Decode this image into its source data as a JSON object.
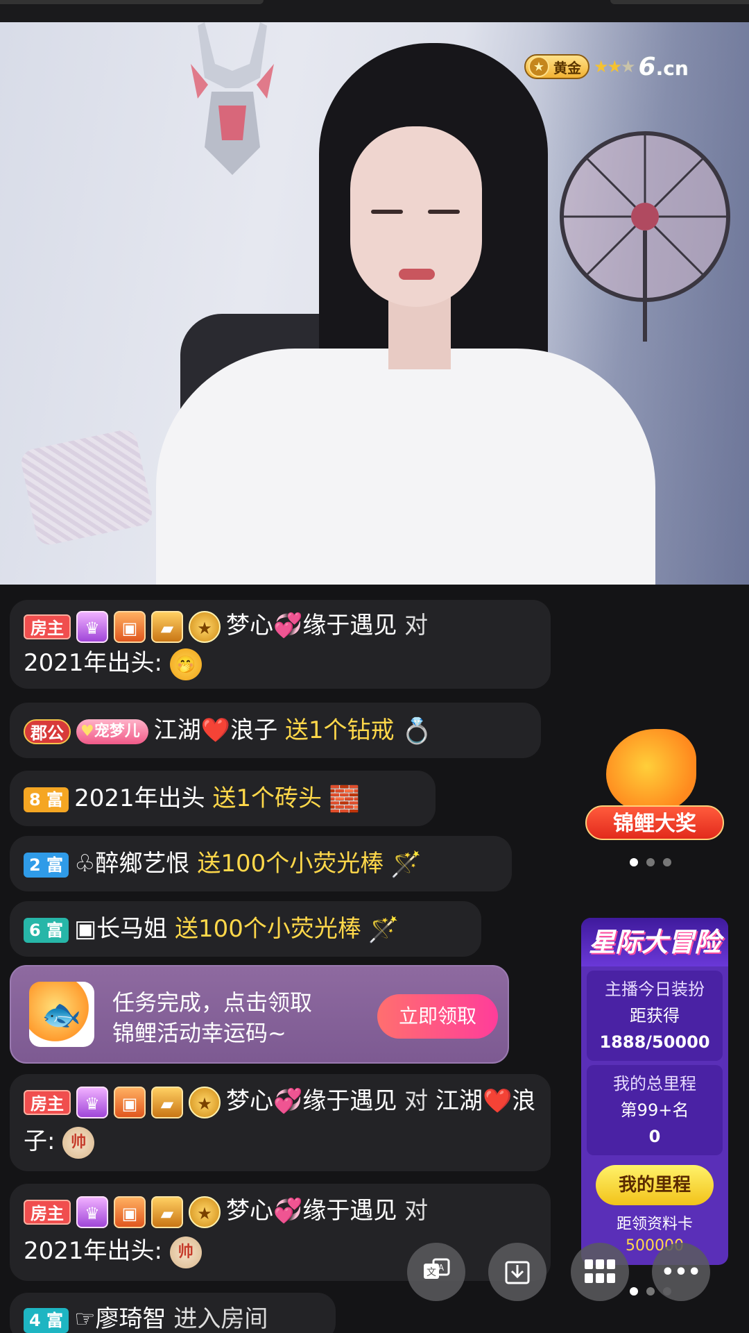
{
  "stream": {
    "level_label": "黄金",
    "stars_filled": 2,
    "stars_total": 3,
    "logo_text": "6",
    "logo_suffix": ".cn"
  },
  "chat": {
    "messages": [
      {
        "tags": [
          "房主"
        ],
        "user": "梦心💞缘于遇见",
        "verb": "对",
        "target": "2021年出头:",
        "emoji": "🤭"
      },
      {
        "tags": [
          "郡公"
        ],
        "nick_badge": "宠梦儿",
        "user": "江湖❤️浪子",
        "gift_text": "送1个钻戒",
        "gift_icon": "💍"
      },
      {
        "tags": [
          "8 富"
        ],
        "user": "2021年出头",
        "gift_text": "送1个砖头",
        "gift_icon": "🧱"
      },
      {
        "tags": [
          "2 富"
        ],
        "user": "♧醉鄉艺恨",
        "gift_text": "送100个小荧光棒",
        "gift_icon": "🪄"
      },
      {
        "tags": [
          "6 富"
        ],
        "user": "▣长马姐",
        "gift_text": "送100个小荧光棒",
        "gift_icon": "🪄"
      },
      {
        "tags": [
          "房主"
        ],
        "user": "梦心💞缘于遇见",
        "verb": "对",
        "target": "江湖❤️浪子:",
        "emoji": "帅"
      },
      {
        "tags": [
          "房主"
        ],
        "user": "梦心💞缘于遇见",
        "verb": "对",
        "target": "2021年出头:",
        "emoji": "帅"
      },
      {
        "tags": [
          "4 富"
        ],
        "user": "☞廖琦智",
        "verb": "进入房间"
      }
    ]
  },
  "task_card": {
    "line1": "任务完成，点击领取",
    "line2": "锦鲤活动幸运码~",
    "button": "立即领取"
  },
  "koi_widget": {
    "label": "锦鲤大奖"
  },
  "star_panel": {
    "title": "星际大冒险",
    "box1_line1": "主播今日装扮",
    "box1_line2": "距获得",
    "box1_line3": "1888/50000",
    "box2_line1": "我的总里程",
    "box2_line2": "第99+名",
    "box2_line3": "0",
    "button": "我的里程",
    "bottom_line1": "距领资料卡",
    "bottom_line2": "500000"
  },
  "fabs": {
    "translate_icon": "translate-icon",
    "download_icon": "download-icon",
    "grid_icon": "grid-icon",
    "more_icon": "more-icon",
    "more_label": "•••"
  }
}
